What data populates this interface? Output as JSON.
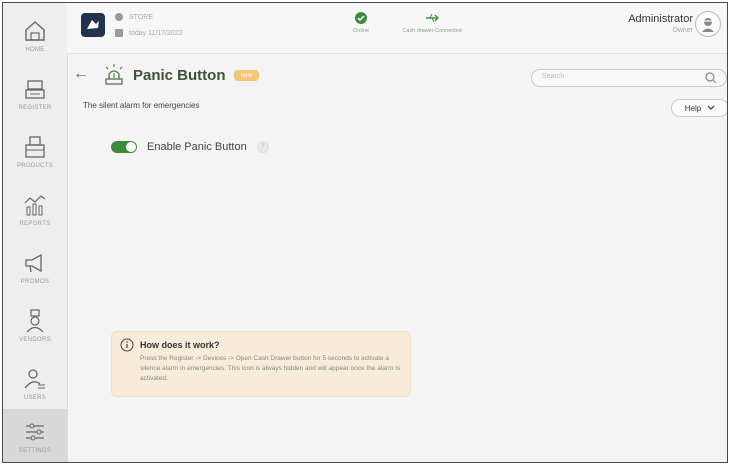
{
  "sidebar": {
    "items": [
      {
        "label": "HOME",
        "icon": "home-icon"
      },
      {
        "label": "REGISTER",
        "icon": "register-icon"
      },
      {
        "label": "PRODUCTS",
        "icon": "products-icon"
      },
      {
        "label": "REPORTS",
        "icon": "reports-icon"
      },
      {
        "label": "PROMOS",
        "icon": "promos-icon"
      },
      {
        "label": "VENDORS",
        "icon": "vendors-icon"
      },
      {
        "label": "USERS",
        "icon": "users-icon"
      },
      {
        "label": "SETTINGS",
        "icon": "settings-icon"
      }
    ]
  },
  "header": {
    "store_name": "STORE",
    "date_text": "today 11/17/2022",
    "status_online": "Online",
    "status_drawer": "Cash drawer Connected",
    "user_name": "Administrator",
    "user_role": "Owner"
  },
  "page": {
    "title": "Panic Button",
    "badge": "new",
    "subtitle": "The silent alarm for emergencies",
    "search_placeholder": "Search",
    "help_label": "Help",
    "toggle_label": "Enable Panic Button",
    "toggle_on": true
  },
  "info": {
    "title": "How does it work?",
    "text": "Press the Register -> Devices -> Open Cash Drawer button for 5 seconds to activate a silence alarm in emergencies. This icon is always hidden and will appear once the alarm is activated."
  },
  "colors": {
    "accent": "#3f8a3c",
    "badge": "#f3c774",
    "info_bg": "#f6ecd9"
  }
}
